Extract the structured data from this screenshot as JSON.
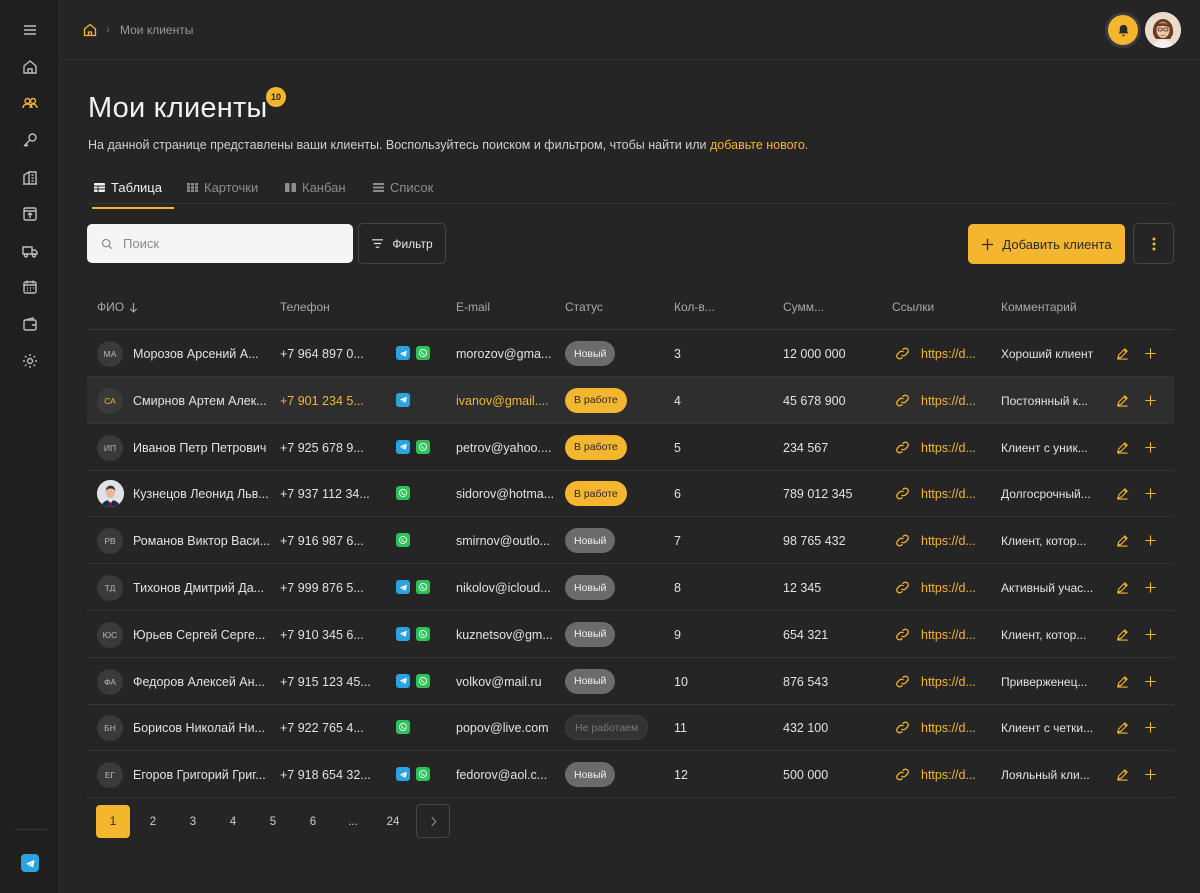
{
  "breadcrumb": {
    "current": "Мои клиенты"
  },
  "page": {
    "title": "Мои клиенты",
    "badge": "10",
    "desc_text": "На данной странице представлены ваши клиенты. Воспользуйтесь поиском и фильтром, чтобы найти или ",
    "desc_link": "добавьте нового."
  },
  "tabs": [
    {
      "label": "Таблица",
      "icon": "table-icon",
      "active": true
    },
    {
      "label": "Карточки",
      "icon": "cards-icon",
      "active": false
    },
    {
      "label": "Канбан",
      "icon": "kanban-icon",
      "active": false
    },
    {
      "label": "Список",
      "icon": "list-icon",
      "active": false
    }
  ],
  "toolbar": {
    "search_placeholder": "Поиск",
    "filter_label": "Фильтр",
    "add_label": "Добавить клиента"
  },
  "columns": {
    "name": "ФИО",
    "phone": "Телефон",
    "email": "E-mail",
    "status": "Статус",
    "count": "Кол-в...",
    "sum": "Сумм...",
    "links": "Ссылки",
    "comment": "Комментарий"
  },
  "rows": [
    {
      "initials": "МА",
      "name": "Морозов Арсений А...",
      "phone": "+7 964 897 0...",
      "email": "morozov@gma...",
      "status": "Новый",
      "status_type": "new",
      "count": "3",
      "sum": "12 000 000",
      "link": "https://d...",
      "comment": "Хороший клиент",
      "tg": true,
      "wa": true
    },
    {
      "initials": "СА",
      "name": "Смирнов Артем Алек...",
      "phone": "+7 901 234 5...",
      "email": "ivanov@gmail....",
      "status": "В работе",
      "status_type": "work",
      "count": "4",
      "sum": "45 678 900",
      "link": "https://d...",
      "comment": "Постоянный к...",
      "tg": true,
      "wa": false
    },
    {
      "initials": "ИП",
      "name": "Иванов Петр Петрович",
      "phone": "+7 925 678 9...",
      "email": "petrov@yahoo....",
      "status": "В работе",
      "status_type": "work",
      "count": "5",
      "sum": "234 567",
      "link": "https://d...",
      "comment": "Клиент с уник...",
      "tg": true,
      "wa": true
    },
    {
      "initials": "",
      "name": "Кузнецов Леонид Льв...",
      "phone": "+7 937 112 34...",
      "email": "sidorov@hotma...",
      "status": "В работе",
      "status_type": "work",
      "count": "6",
      "sum": "789 012 345",
      "link": "https://d...",
      "comment": "Долгосрочный...",
      "tg": false,
      "wa": true
    },
    {
      "initials": "РВ",
      "name": "Романов Виктор Васи...",
      "phone": "+7 916 987 6...",
      "email": "smirnov@outlo...",
      "status": "Новый",
      "status_type": "new",
      "count": "7",
      "sum": "98 765 432",
      "link": "https://d...",
      "comment": "Клиент, котор...",
      "tg": false,
      "wa": true
    },
    {
      "initials": "ТД",
      "name": "Тихонов Дмитрий Да...",
      "phone": "+7 999 876 5...",
      "email": "nikolov@icloud...",
      "status": "Новый",
      "status_type": "new",
      "count": "8",
      "sum": "12 345",
      "link": "https://d...",
      "comment": "Активный учас...",
      "tg": true,
      "wa": true
    },
    {
      "initials": "ЮС",
      "name": "Юрьев Сергей Серге...",
      "phone": "+7 910 345 6...",
      "email": "kuznetsov@gm...",
      "status": "Новый",
      "status_type": "new",
      "count": "9",
      "sum": "654 321",
      "link": "https://d...",
      "comment": "Клиент, котор...",
      "tg": true,
      "wa": true
    },
    {
      "initials": "ФА",
      "name": "Федоров Алексей Ан...",
      "phone": "+7 915 123 45...",
      "email": "volkov@mail.ru",
      "status": "Новый",
      "status_type": "new",
      "count": "10",
      "sum": "876 543",
      "link": "https://d...",
      "comment": "Приверженец...",
      "tg": true,
      "wa": true
    },
    {
      "initials": "БН",
      "name": "Борисов Николай Ни...",
      "phone": "+7 922 765 4...",
      "email": "popov@live.com",
      "status": "Не работаем",
      "status_type": "stop",
      "count": "11",
      "sum": "432 100",
      "link": "https://d...",
      "comment": "Клиент с четки...",
      "tg": false,
      "wa": true
    },
    {
      "initials": "ЕГ",
      "name": "Егоров Григорий Григ...",
      "phone": "+7 918 654 32...",
      "email": "fedorov@aol.c...",
      "status": "Новый",
      "status_type": "new",
      "count": "12",
      "sum": "500 000",
      "link": "https://d...",
      "comment": "Лояльный кли...",
      "tg": true,
      "wa": true
    }
  ],
  "pagination": [
    "1",
    "2",
    "3",
    "4",
    "5",
    "6",
    "...",
    "24"
  ],
  "colors": {
    "accent": "#f4b52f",
    "background": "#252525",
    "sidebar": "#1f1f1f"
  }
}
